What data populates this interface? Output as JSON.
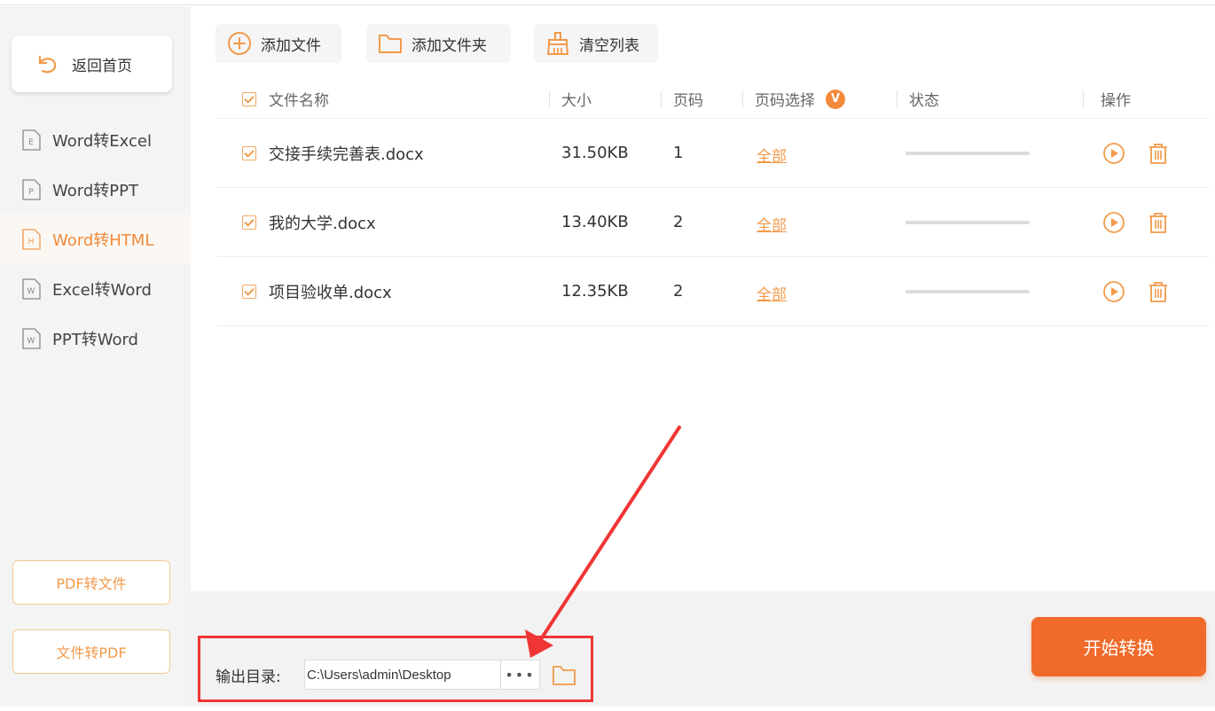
{
  "sidebar": {
    "back_label": "返回首页",
    "items": [
      {
        "label": "Word转Excel",
        "icon_letter": "E",
        "active": false
      },
      {
        "label": "Word转PPT",
        "icon_letter": "P",
        "active": false
      },
      {
        "label": "Word转HTML",
        "icon_letter": "H",
        "active": true
      },
      {
        "label": "Excel转Word",
        "icon_letter": "W",
        "active": false
      },
      {
        "label": "PPT转Word",
        "icon_letter": "W",
        "active": false
      }
    ],
    "pdf_to_file": "PDF转文件",
    "file_to_pdf": "文件转PDF"
  },
  "toolbar": {
    "add_file": "添加文件",
    "add_folder": "添加文件夹",
    "clear_list": "清空列表"
  },
  "table": {
    "headers": {
      "name": "文件名称",
      "size": "大小",
      "pages": "页码",
      "page_select": "页码选择",
      "status": "状态",
      "actions": "操作"
    },
    "badge": "V",
    "rows": [
      {
        "name": "交接手续完善表.docx",
        "size": "31.50KB",
        "pages": "1",
        "page_select": "全部"
      },
      {
        "name": "我的大学.docx",
        "size": "13.40KB",
        "pages": "2",
        "page_select": "全部"
      },
      {
        "name": "项目验收单.docx",
        "size": "12.35KB",
        "pages": "2",
        "page_select": "全部"
      }
    ]
  },
  "output": {
    "label": "输出目录:",
    "path": "C:\\Users\\admin\\Desktop",
    "browse": "•••"
  },
  "start_label": "开始转换",
  "colors": {
    "accent": "#f06a2a",
    "accent_light": "#f29a4a",
    "highlight_red": "#f03535"
  }
}
